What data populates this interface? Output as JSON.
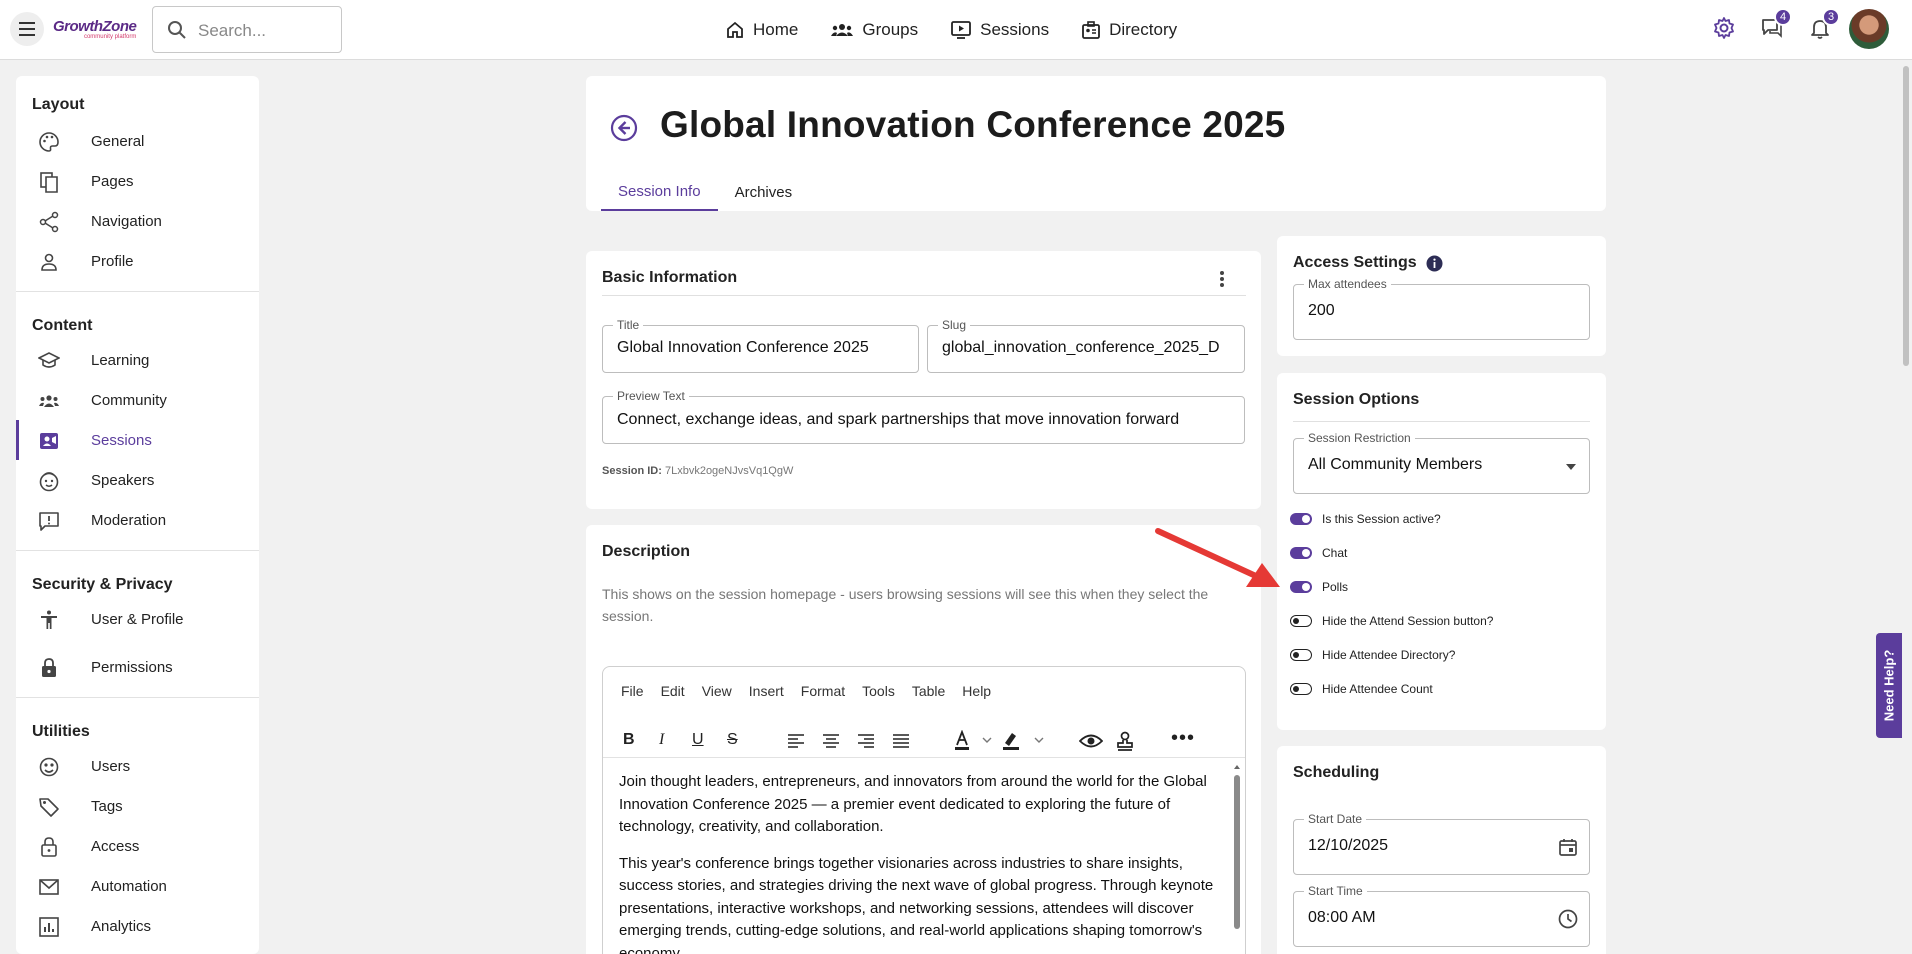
{
  "app": {
    "logo_main": "GrowthZone",
    "logo_sub": "community platform",
    "search_placeholder": "Search..."
  },
  "topnav": [
    {
      "label": "Home",
      "icon": "home-icon"
    },
    {
      "label": "Groups",
      "icon": "groups-icon"
    },
    {
      "label": "Sessions",
      "icon": "sessions-icon"
    },
    {
      "label": "Directory",
      "icon": "directory-icon"
    }
  ],
  "badges": {
    "messages": "4",
    "notifications": "3"
  },
  "sidebar": {
    "layout": {
      "title": "Layout",
      "items": [
        "General",
        "Pages",
        "Navigation",
        "Profile"
      ]
    },
    "content": {
      "title": "Content",
      "items": [
        "Learning",
        "Community",
        "Sessions",
        "Speakers",
        "Moderation"
      ]
    },
    "security": {
      "title": "Security & Privacy",
      "items": [
        "User & Profile",
        "Permissions"
      ]
    },
    "utilities": {
      "title": "Utilities",
      "items": [
        "Users",
        "Tags",
        "Access",
        "Automation",
        "Analytics"
      ]
    }
  },
  "header": {
    "title": "Global Innovation Conference 2025",
    "tabs": [
      "Session Info",
      "Archives"
    ]
  },
  "basic": {
    "title": "Basic Information",
    "title_label": "Title",
    "title_value": "Global Innovation Conference 2025",
    "slug_label": "Slug",
    "slug_value": "global_innovation_conference_2025_D",
    "preview_label": "Preview Text",
    "preview_value": "Connect, exchange ideas, and spark partnerships that move innovation forward",
    "session_id_label": "Session ID:",
    "session_id_value": "7Lxbvk2ogeNJvsVq1QgW"
  },
  "description": {
    "title": "Description",
    "help": "This shows on the session homepage - users browsing sessions will see this when they select the session.",
    "menu": [
      "File",
      "Edit",
      "View",
      "Insert",
      "Format",
      "Tools",
      "Table",
      "Help"
    ],
    "paragraphs": [
      "Join thought leaders, entrepreneurs, and innovators from around the world for the Global Innovation Conference 2025 — a premier event dedicated to exploring the future of technology, creativity, and collaboration.",
      "This year's conference brings together visionaries across industries to share insights, success stories, and strategies driving the next wave of global progress. Through keynote presentations, interactive workshops, and networking sessions, attendees will discover emerging trends, cutting-edge solutions, and real-world applications shaping tomorrow's economy."
    ]
  },
  "access": {
    "title": "Access Settings",
    "max_label": "Max attendees",
    "max_value": "200"
  },
  "options": {
    "title": "Session Options",
    "restriction_label": "Session Restriction",
    "restriction_value": "All Community Members",
    "toggles": [
      {
        "label": "Is this Session active?",
        "on": true
      },
      {
        "label": "Chat",
        "on": true
      },
      {
        "label": "Polls",
        "on": true
      },
      {
        "label": "Hide the Attend Session button?",
        "on": false
      },
      {
        "label": "Hide Attendee Directory?",
        "on": false
      },
      {
        "label": "Hide Attendee Count",
        "on": false
      }
    ]
  },
  "scheduling": {
    "title": "Scheduling",
    "start_date_label": "Start Date",
    "start_date_value": "12/10/2025",
    "start_time_label": "Start Time",
    "start_time_value": "08:00 AM"
  },
  "help_tab": "Need Help?",
  "colors": {
    "accent": "#5b3d9c",
    "arrow": "#e53935"
  }
}
